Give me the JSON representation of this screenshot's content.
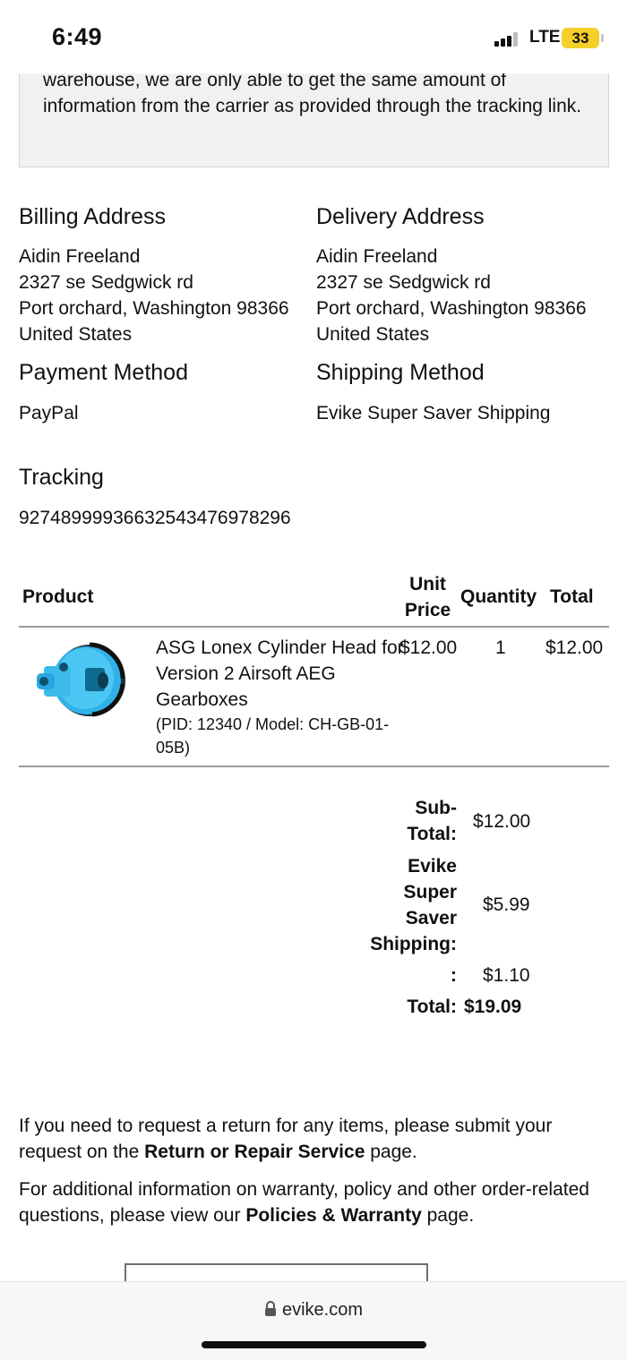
{
  "status_bar": {
    "time": "6:49",
    "network": "LTE",
    "battery": "33"
  },
  "notice": {
    "text": "warehouse, we are only able to get the same amount of information from the carrier as provided through the tracking link."
  },
  "billing": {
    "heading": "Billing Address",
    "name": "Aidin Freeland",
    "street": "2327 se Sedgwick rd",
    "city_line": "Port orchard, Washington 98366",
    "country": "United States"
  },
  "delivery": {
    "heading": "Delivery Address",
    "name": "Aidin Freeland",
    "street": "2327 se Sedgwick rd",
    "city_line": "Port orchard, Washington 98366",
    "country": "United States"
  },
  "payment": {
    "heading": "Payment Method",
    "value": "PayPal"
  },
  "shipping": {
    "heading": "Shipping Method",
    "value": "Evike Super Saver Shipping"
  },
  "tracking": {
    "heading": "Tracking",
    "number": "9274899993663254347697829​6"
  },
  "table": {
    "headers": {
      "product": "Product",
      "unit_price_1": "Unit",
      "unit_price_2": "Price",
      "quantity": "Quantity",
      "total": "Total"
    },
    "rows": [
      {
        "name_1": "ASG Lonex Cylinder Head for",
        "name_2": "Version 2 Airsoft AEG",
        "name_3": "Gearboxes",
        "meta_1": "(PID: 12340 / Model: CH-GB-01-",
        "meta_2": "05B)",
        "unit_price": "$12.00",
        "quantity": "1",
        "total": "$12.00",
        "image": "cylinder-head-photo"
      }
    ]
  },
  "totals": {
    "subtotal_label_1": "Sub-",
    "subtotal_label_2": "Total:",
    "subtotal_value": "$12.00",
    "shipping_label_1": "Evike",
    "shipping_label_2": "Super",
    "shipping_label_3": "Saver",
    "shipping_label_4": "Shipping:",
    "shipping_value": "$5.99",
    "tax_label": ":",
    "tax_value": "$1.10",
    "total_label": "Total:",
    "total_value": "$19.09"
  },
  "footer": {
    "return_pre": "If you need to request a return for any items, please submit your request on the ",
    "return_link": "Return or Repair Service",
    "return_post": " page.",
    "policy_pre": "For additional information on warranty, policy and other order-related questions, please view our ",
    "policy_link": "Policies & Warranty",
    "policy_post": " page."
  },
  "browser": {
    "url": "evike.com"
  }
}
